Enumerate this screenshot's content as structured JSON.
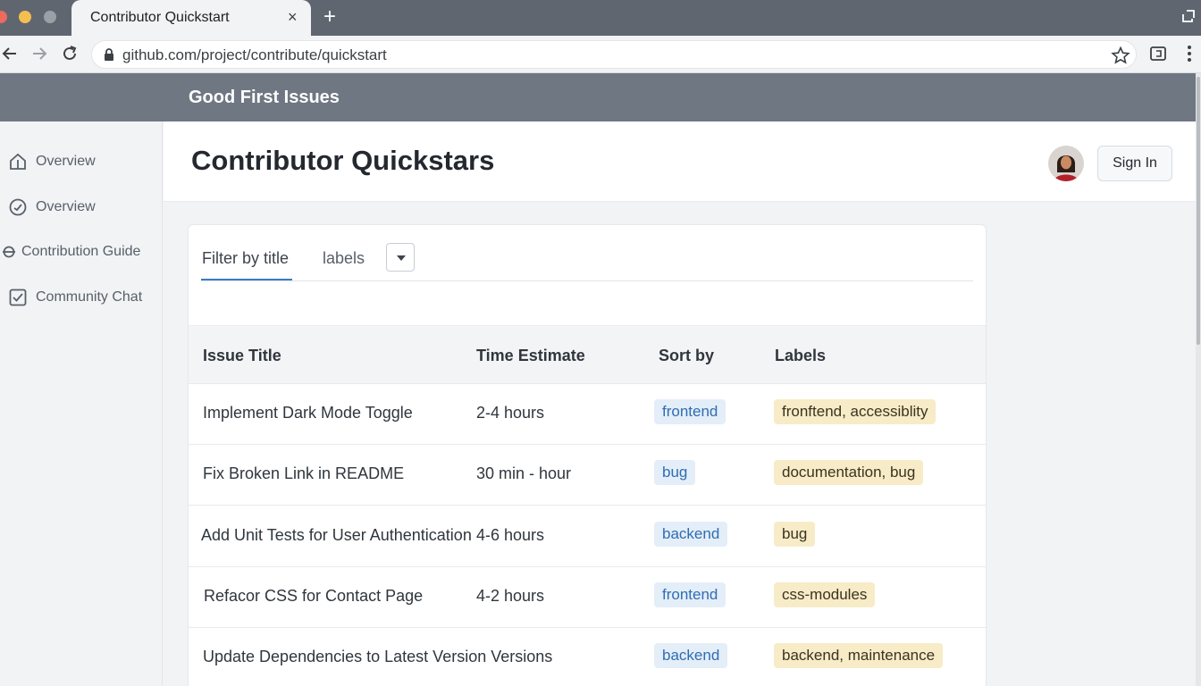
{
  "browser": {
    "tab_title": "Contributor Quickstart",
    "tab_close": "×",
    "new_tab": "+",
    "url": "github.com/project/contribute/quickstart",
    "icons": [
      "back-icon",
      "forward-icon",
      "reload-icon",
      "lock-icon",
      "star-icon",
      "extension-icon",
      "menu-icon"
    ]
  },
  "band": {
    "title": "Good First Issues"
  },
  "sidebar": {
    "items": [
      {
        "label": "Overview",
        "icon": "home-icon"
      },
      {
        "label": "Overview",
        "icon": "dashboard-icon"
      },
      {
        "label": "Contribution Guide",
        "icon": "guide-icon"
      },
      {
        "label": "Community Chat",
        "icon": "checkbox-icon"
      }
    ]
  },
  "header": {
    "title": "Contributor Quickstars",
    "signin_label": "Sign In"
  },
  "filters": {
    "title_tab": "Filter by title",
    "labels_tab": "labels"
  },
  "table": {
    "headers": [
      "Issue Title",
      "Time Estimate",
      "Sort by",
      "Labels"
    ],
    "rows": [
      {
        "title": "Implement Dark Mode Toggle",
        "time": "2-4 hours",
        "tag": "frontend",
        "labels": "fronftend, accessiblity"
      },
      {
        "title": "Fix Broken Link in README",
        "time": "30 min - hour",
        "tag": "bug",
        "labels": "documentation, bug"
      },
      {
        "title": "Add Unit Tests for User Authentication",
        "time": "4-6 hours",
        "tag": "backend",
        "labels": "bug"
      },
      {
        "title": "Refacor CSS for Contact Page",
        "time": "4-2 hours",
        "tag": "frontend",
        "labels": "css-modules"
      },
      {
        "title": "Update Dependencies to Latest Version Versions",
        "time": "",
        "tag": "backend",
        "labels": "backend, maintenance"
      }
    ]
  },
  "colors": {
    "accent": "#3a7bc8",
    "band": "#6f7782",
    "tag_blue_bg": "#e4eef8",
    "tag_yellow_bg": "#f7ecc7"
  }
}
